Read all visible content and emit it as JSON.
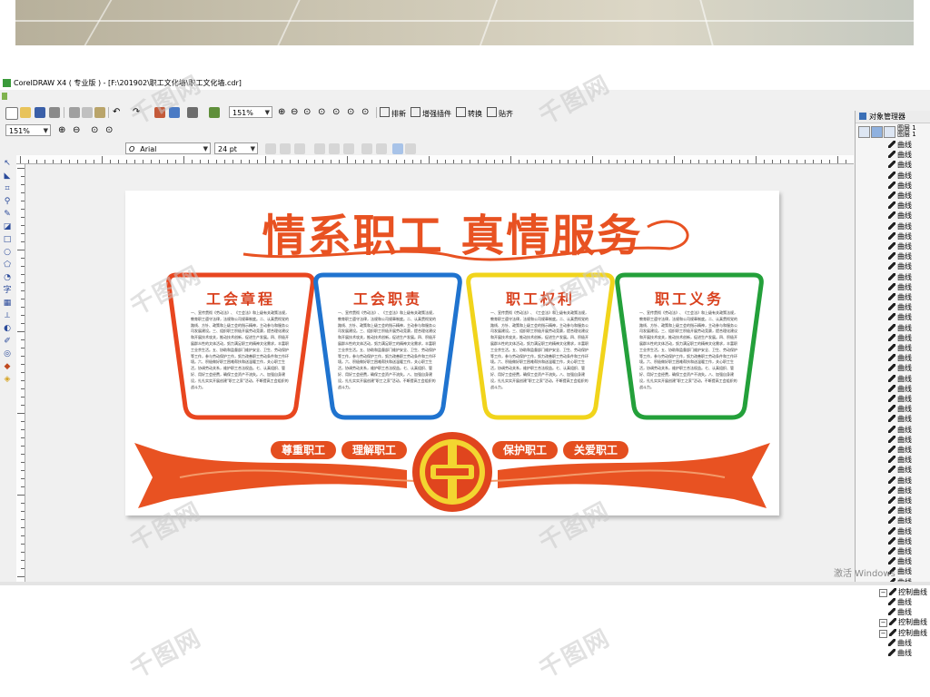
{
  "window": {
    "title": "CorelDRAW X4 ( 专业版 ) - [F:\\201902\\职工文化墙\\职工文化墙.cdr]"
  },
  "toolbar": {
    "zoom_main": "151%",
    "zoom_secondary": "151%",
    "font_name": "Arial",
    "font_size": "24 pt",
    "font_style_glyph": "O",
    "buttons": {
      "typeset": "排新",
      "enhance_plugin": "增强插件",
      "convert": "转换",
      "paste": "贴齐"
    }
  },
  "docker": {
    "title": "对象管理器",
    "layer_rows": [
      "图层 1",
      "图层 1"
    ],
    "items": [
      "曲线",
      "曲线",
      "曲线",
      "曲线",
      "曲线",
      "曲线",
      "曲线",
      "曲线",
      "曲线",
      "曲线",
      "曲线",
      "曲线",
      "曲线",
      "曲线",
      "曲线",
      "曲线",
      "曲线",
      "曲线",
      "曲线",
      "曲线",
      "曲线",
      "曲线",
      "曲线",
      "曲线",
      "曲线",
      "曲线",
      "曲线",
      "曲线",
      "曲线",
      "曲线",
      "曲线",
      "曲线",
      "曲线",
      "曲线",
      "曲线",
      "曲线",
      "曲线",
      "曲线",
      "曲线",
      "曲线",
      "曲线",
      "曲线",
      "曲线",
      "曲线"
    ],
    "groups": [
      {
        "label": "控制曲线",
        "children": [
          "曲线",
          "曲线"
        ]
      },
      {
        "label": "控制曲线",
        "children": []
      },
      {
        "label": "控制曲线",
        "children": [
          "曲线",
          "曲线"
        ]
      }
    ]
  },
  "design": {
    "headline": "情系职工  真情服务",
    "panels": [
      {
        "title": "工会章程",
        "color": "#e8461f"
      },
      {
        "title": "工会职责",
        "color": "#1f73cf"
      },
      {
        "title": "职工权利",
        "color": "#f1d41b"
      },
      {
        "title": "职工义务",
        "color": "#23a03a"
      }
    ],
    "panel_text": "一、宣传贯彻《劳动法》、《工会法》和上级有关政策法规，教育职工遵守法律，法规和公司规章制度。二、认真贯彻党的路线、方针、政策和上级工会的指示精神，主动参与和服务公司发展建设。三、组织职工积极开展劳动竞赛，提合理化建议和开展技术攻关，推动技术创新，促进生产发展。四、积极开展群众性的文体活动，努力满足职工的精神文化需求，丰富职工业余生活。五、协助和监督部门维护安全、卫生、劳动保护等工作，参与劳动保护工作，努力改善职工劳动条件和工作环境。六、积极做好职工困难帮扶和送温暖工作，关心职工生活，协调劳动关系，维护职工合法权益。七、认真组织、管好、用好工会经费，确保工会资产不流失。八、加强自身建设，扎扎实实开展创建\"职工之家\"活动，不断提高工会组织的战斗力。",
    "mottos": [
      "尊重职工",
      "理解职工",
      "保护职工",
      "关爱职工"
    ],
    "colors": {
      "orange": "#e85222",
      "emblem_red": "#e0451e",
      "emblem_yellow": "#f3d530"
    }
  },
  "watermark": "千图网",
  "os_notice": "激活 Windows"
}
